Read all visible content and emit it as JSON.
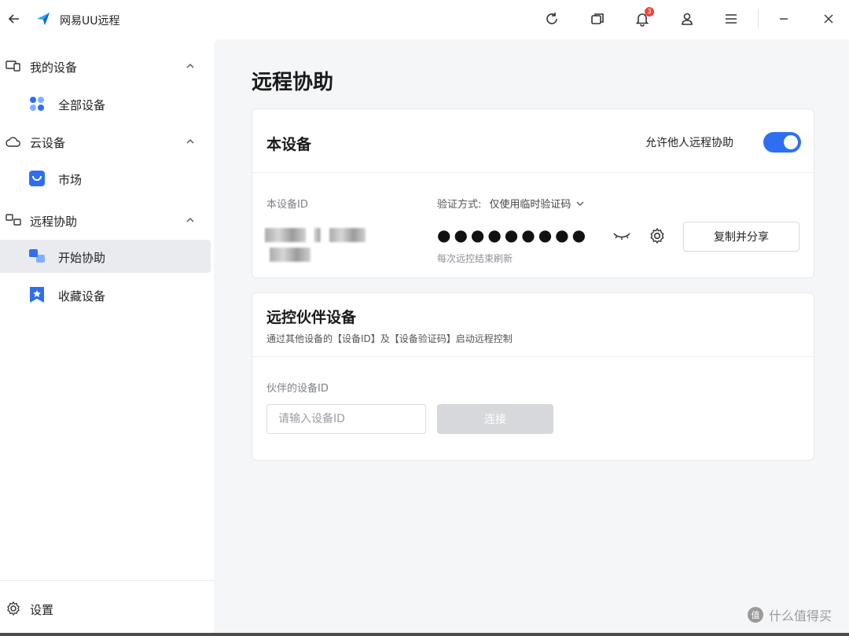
{
  "titlebar": {
    "app_title": "网易UU远程",
    "notification_count": "3",
    "icons": [
      "back-arrow-icon",
      "app-logo-icon",
      "refresh-icon",
      "window-switch-icon",
      "bell-icon",
      "user-icon",
      "menu-icon",
      "minimize-icon",
      "close-icon"
    ]
  },
  "sidebar": {
    "groups": [
      {
        "label": "我的设备",
        "icon": "devices-icon",
        "items": [
          {
            "label": "全部设备",
            "icon": "grid-dots-icon"
          }
        ]
      },
      {
        "label": "云设备",
        "icon": "cloud-icon",
        "items": [
          {
            "label": "市场",
            "icon": "market-bag-icon"
          }
        ]
      },
      {
        "label": "远程协助",
        "icon": "remote-icon",
        "items": [
          {
            "label": "开始协助",
            "icon": "start-assist-icon",
            "active": true
          },
          {
            "label": "收藏设备",
            "icon": "bookmark-star-icon"
          }
        ]
      }
    ],
    "settings_label": "设置"
  },
  "main": {
    "page_title": "远程协助",
    "this_device": {
      "title": "本设备",
      "allow_label": "允许他人远程协助",
      "allow_enabled": true,
      "device_id_label": "本设备ID",
      "verify_label": "验证方式:",
      "verify_value": "仅使用临时验证码",
      "password_masked": "●●●●●●●●●",
      "refresh_hint": "每次远控结束刷新",
      "copy_button": "复制并分享"
    },
    "partner": {
      "title": "远控伙伴设备",
      "subtitle": "通过其他设备的【设备ID】及【设备验证码】启动远程控制",
      "device_id_label": "伙伴的设备ID",
      "input_placeholder": "请输入设备ID",
      "input_value": "",
      "connect_button": "连接"
    }
  },
  "watermark": {
    "text": "什么值得买"
  },
  "colors": {
    "accent": "#2e6ff2",
    "badge": "#f0433a",
    "disabled": "#d7d8db"
  }
}
